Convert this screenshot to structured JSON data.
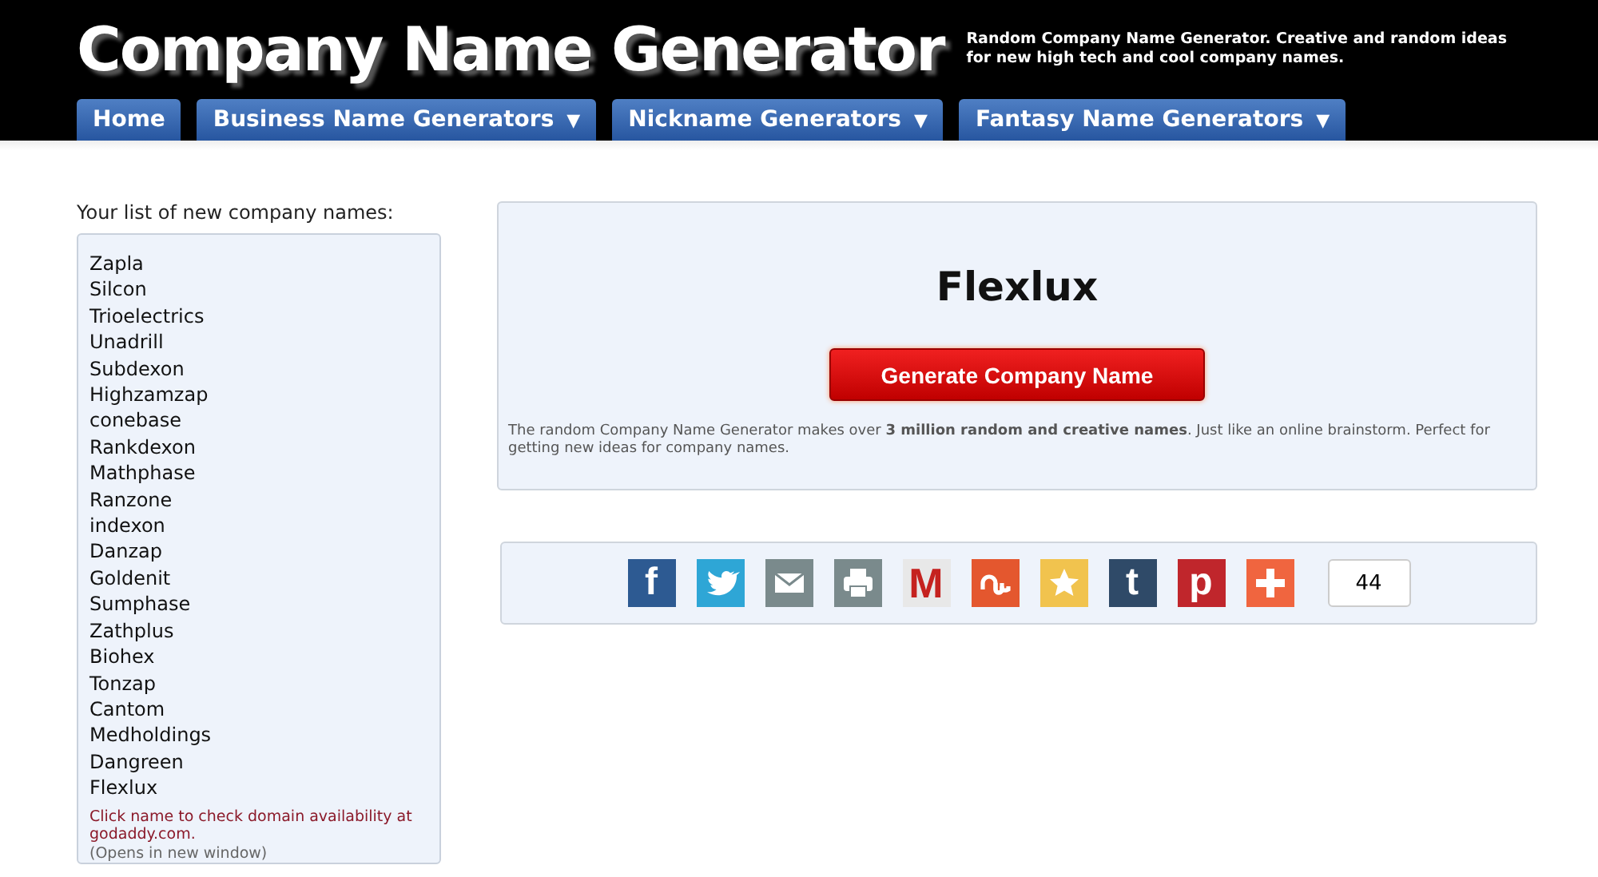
{
  "header": {
    "title": "Company Name Generator",
    "tagline": "Random Company Name Generator. Creative and random ideas for new high tech and cool company names."
  },
  "nav": [
    {
      "label": "Home",
      "dropdown": false
    },
    {
      "label": "Business Name Generators",
      "dropdown": true
    },
    {
      "label": "Nickname Generators",
      "dropdown": true
    },
    {
      "label": "Fantasy Name Generators",
      "dropdown": true
    }
  ],
  "nav_caret": "▼",
  "list_heading": "Your list of new company names:",
  "names": [
    "Zapla",
    "Silcon",
    "Trioelectrics",
    "Unadrill",
    "Subdexon",
    "Highzamzap",
    "conebase",
    "Rankdexon",
    "Mathphase",
    "Ranzone",
    "indexon",
    "Danzap",
    "Goldenit",
    "Sumphase",
    "Zathplus",
    "Biohex",
    "Tonzap",
    "Cantom",
    "Medholdings",
    "Dangreen",
    "Flexlux"
  ],
  "domain_link": "Click name to check domain availability at godaddy.com.",
  "domain_note": "(Opens in new window)",
  "result": "Flexlux",
  "generate_button": "Generate Company Name",
  "description": "The random Company Name Generator makes over **3 million random and creative names**. Just like an online brainstorm. Perfect for getting new ideas for company names.",
  "share": [
    {
      "kind": "facebook",
      "glyph": "f"
    },
    {
      "kind": "twitter"
    },
    {
      "kind": "email"
    },
    {
      "kind": "print"
    },
    {
      "kind": "gmail",
      "glyph": "M"
    },
    {
      "kind": "stumbleupon"
    },
    {
      "kind": "favorite"
    },
    {
      "kind": "tumblr",
      "glyph": "t"
    },
    {
      "kind": "pinterest",
      "glyph": "p"
    },
    {
      "kind": "more"
    }
  ],
  "share_count": "44"
}
